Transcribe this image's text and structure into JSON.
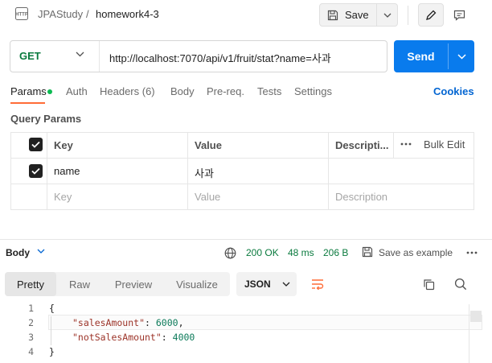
{
  "header": {
    "collection": "JPAStudy",
    "separator": "/",
    "request_name": "homework4-3",
    "save_label": "Save"
  },
  "request": {
    "method": "GET",
    "url": "http://localhost:7070/api/v1/fruit/stat?name=사과",
    "send_label": "Send"
  },
  "request_tabs": [
    {
      "label": "Params"
    },
    {
      "label": "Auth"
    },
    {
      "label": "Headers (6)"
    },
    {
      "label": "Body"
    },
    {
      "label": "Pre-req."
    },
    {
      "label": "Tests"
    },
    {
      "label": "Settings"
    }
  ],
  "cookies_label": "Cookies",
  "query_params": {
    "title": "Query Params",
    "columns": {
      "key": "Key",
      "value": "Value",
      "description": "Descripti..."
    },
    "bulk_edit_label": "Bulk Edit",
    "rows": [
      {
        "checked": true,
        "key": "name",
        "value": "사과",
        "description": ""
      }
    ],
    "placeholders": {
      "key": "Key",
      "value": "Value",
      "description": "Description"
    }
  },
  "response": {
    "section_label": "Body",
    "status": "200 OK",
    "time": "48 ms",
    "size": "206 B",
    "save_example_label": "Save as example",
    "view_tabs": [
      {
        "label": "Pretty",
        "active": true
      },
      {
        "label": "Raw",
        "active": false
      },
      {
        "label": "Preview",
        "active": false
      },
      {
        "label": "Visualize",
        "active": false
      }
    ],
    "format": "JSON",
    "code": {
      "line_numbers": [
        "1",
        "2",
        "3",
        "4"
      ],
      "open_brace": "{",
      "close_brace": "}",
      "key1": "\"salesAmount\"",
      "value1": "6000",
      "key2": "\"notSalesAmount\"",
      "value2": "4000",
      "colon": ": ",
      "comma": ","
    }
  },
  "colors": {
    "accent": "#ff6c37",
    "send": "#097bed",
    "method_get": "#0a7a3e",
    "status_ok": "#0a7a3e"
  }
}
